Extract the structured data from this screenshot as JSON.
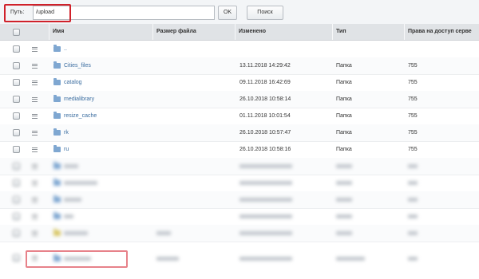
{
  "toolbar": {
    "path_label": "Путь:",
    "path_value": "/upload",
    "ok_label": "OK",
    "search_label": "Поиск"
  },
  "table": {
    "columns": [
      "Имя",
      "Размер файла",
      "Изменено",
      "Тип",
      "Права на доступ серве"
    ],
    "rows": [
      {
        "name": "..",
        "size": "",
        "modified": "",
        "type": "",
        "perms": ""
      },
      {
        "name": "Cities_files",
        "size": "",
        "modified": "13.11.2018 14:29:42",
        "type": "Папка",
        "perms": "755"
      },
      {
        "name": "catalog",
        "size": "",
        "modified": "09.11.2018 16:42:69",
        "type": "Папка",
        "perms": "755"
      },
      {
        "name": "medialibrary",
        "size": "",
        "modified": "26.10.2018 10:58:14",
        "type": "Папка",
        "perms": "755"
      },
      {
        "name": "resize_cache",
        "size": "",
        "modified": "01.11.2018 10:01:54",
        "type": "Папка",
        "perms": "755"
      },
      {
        "name": "rk",
        "size": "",
        "modified": "26.10.2018 10:57:47",
        "type": "Папка",
        "perms": "755"
      },
      {
        "name": "ru",
        "size": "",
        "modified": "26.10.2018 10:58:16",
        "type": "Папка",
        "perms": "755"
      }
    ]
  }
}
